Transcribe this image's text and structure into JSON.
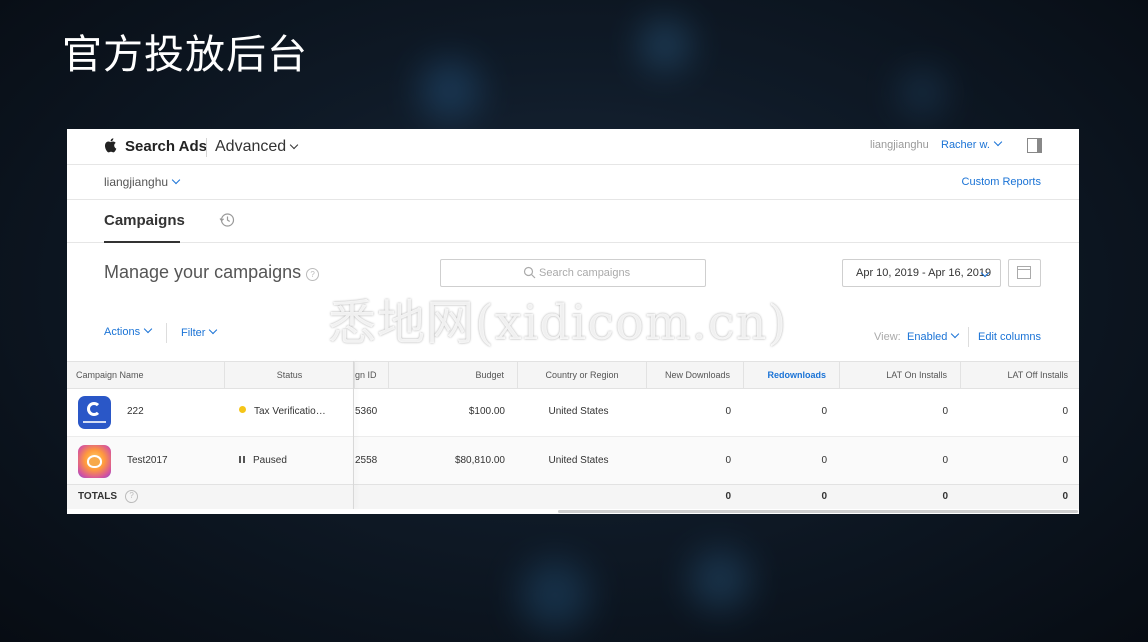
{
  "slide": {
    "title": "官方投放后台",
    "watermark": "悉地网(xidicom.cn)"
  },
  "header": {
    "brand": "Search Ads",
    "product": "Advanced",
    "org_name": "liangjianghu",
    "user": "Racher w."
  },
  "subheader": {
    "org_switcher": "liangjianghu",
    "custom_reports": "Custom Reports"
  },
  "tabs": {
    "campaigns": "Campaigns"
  },
  "main": {
    "title": "Manage your campaigns",
    "help_glyph": "?",
    "search_placeholder": "Search campaigns",
    "date_range": "Apr 10, 2019 - Apr 16, 2019",
    "actions_label": "Actions",
    "filter_label": "Filter",
    "view_label": "View:",
    "view_value": "Enabled",
    "edit_columns": "Edit columns"
  },
  "table": {
    "columns": {
      "campaign_name": "Campaign Name",
      "status": "Status",
      "campaign_id": "gn ID",
      "budget": "Budget",
      "country": "Country or Region",
      "new_downloads": "New Downloads",
      "redownloads": "Redownloads",
      "lat_on": "LAT On Installs",
      "lat_off": "LAT Off Installs"
    },
    "rows": [
      {
        "name": "222",
        "status": "Tax Verificatio…",
        "status_color": "#f5c518",
        "campaign_id": "5360",
        "budget": "$100.00",
        "country": "United States",
        "new_downloads": "0",
        "redownloads": "0",
        "lat_on": "0",
        "lat_off": "0"
      },
      {
        "name": "Test2017",
        "status": "Paused",
        "campaign_id": "2558",
        "budget": "$80,810.00",
        "country": "United States",
        "new_downloads": "0",
        "redownloads": "0",
        "lat_on": "0",
        "lat_off": "0"
      }
    ],
    "totals": {
      "label": "TOTALS",
      "help_glyph": "?",
      "new_downloads": "0",
      "redownloads": "0",
      "lat_on": "0",
      "lat_off": "0"
    }
  },
  "colors": {
    "accent": "#1a73d6",
    "background": "#0f1a27"
  }
}
